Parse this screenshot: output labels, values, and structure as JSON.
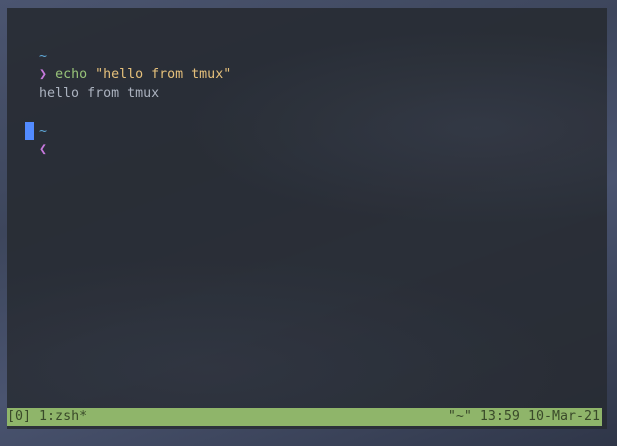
{
  "terminal": {
    "lines": [
      {
        "tilde": "~"
      },
      {
        "prompt": "❯",
        "command": "echo",
        "argument": "\"hello from tmux\""
      },
      {
        "output": "hello from tmux"
      },
      {
        "tilde": "~"
      },
      {
        "prompt": "❮"
      }
    ]
  },
  "statusbar": {
    "session": "[0]",
    "window": "1:zsh*",
    "right": "\"~\" 13:59 10-Mar-21"
  },
  "colors": {
    "terminal_bg": "#282c34",
    "tilde": "#5fa8d8",
    "prompt": "#c678dd",
    "command": "#98c379",
    "string": "#e5c07b",
    "output": "#abb2bf",
    "cursor": "#528bff",
    "statusbar_bg": "#8fb56a",
    "statusbar_fg": "#3a4a2a"
  },
  "icons": {
    "prompt_insert": "chevron-right-icon",
    "prompt_normal": "chevron-left-icon"
  }
}
